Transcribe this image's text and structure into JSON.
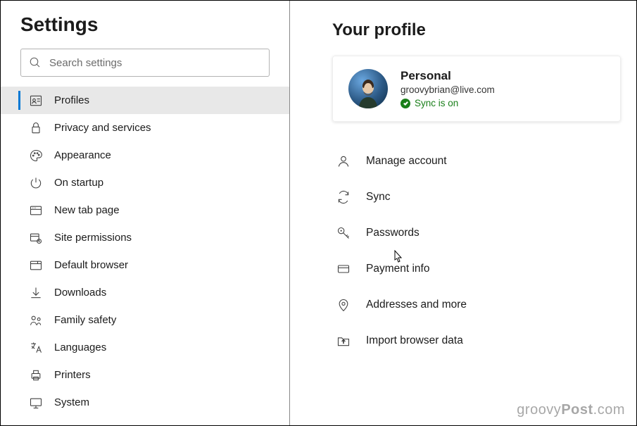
{
  "header": {
    "title": "Settings"
  },
  "search": {
    "placeholder": "Search settings"
  },
  "sidebar": {
    "items": [
      {
        "key": "profiles",
        "label": "Profiles",
        "icon": "profile-card-icon",
        "active": true
      },
      {
        "key": "privacy",
        "label": "Privacy and services",
        "icon": "lock-icon"
      },
      {
        "key": "appearance",
        "label": "Appearance",
        "icon": "palette-icon"
      },
      {
        "key": "startup",
        "label": "On startup",
        "icon": "power-icon"
      },
      {
        "key": "newtab",
        "label": "New tab page",
        "icon": "newtab-icon"
      },
      {
        "key": "sitepermissions",
        "label": "Site permissions",
        "icon": "site-perm-icon"
      },
      {
        "key": "defaultbrowser",
        "label": "Default browser",
        "icon": "browser-icon"
      },
      {
        "key": "downloads",
        "label": "Downloads",
        "icon": "download-icon"
      },
      {
        "key": "family",
        "label": "Family safety",
        "icon": "family-icon"
      },
      {
        "key": "languages",
        "label": "Languages",
        "icon": "language-icon"
      },
      {
        "key": "printers",
        "label": "Printers",
        "icon": "printer-icon"
      },
      {
        "key": "system",
        "label": "System",
        "icon": "system-icon"
      }
    ]
  },
  "main": {
    "heading": "Your profile",
    "profile": {
      "name": "Personal",
      "email": "groovybrian@live.com",
      "sync_status": "Sync is on"
    },
    "options": [
      {
        "key": "manageaccount",
        "label": "Manage account",
        "icon": "person-icon"
      },
      {
        "key": "sync",
        "label": "Sync",
        "icon": "sync-icon"
      },
      {
        "key": "passwords",
        "label": "Passwords",
        "icon": "key-icon"
      },
      {
        "key": "payment",
        "label": "Payment info",
        "icon": "card-icon"
      },
      {
        "key": "addresses",
        "label": "Addresses and more",
        "icon": "location-icon"
      },
      {
        "key": "import",
        "label": "Import browser data",
        "icon": "import-icon"
      }
    ]
  },
  "watermark": {
    "a": "groovy",
    "b": "Post",
    "c": ".com"
  }
}
